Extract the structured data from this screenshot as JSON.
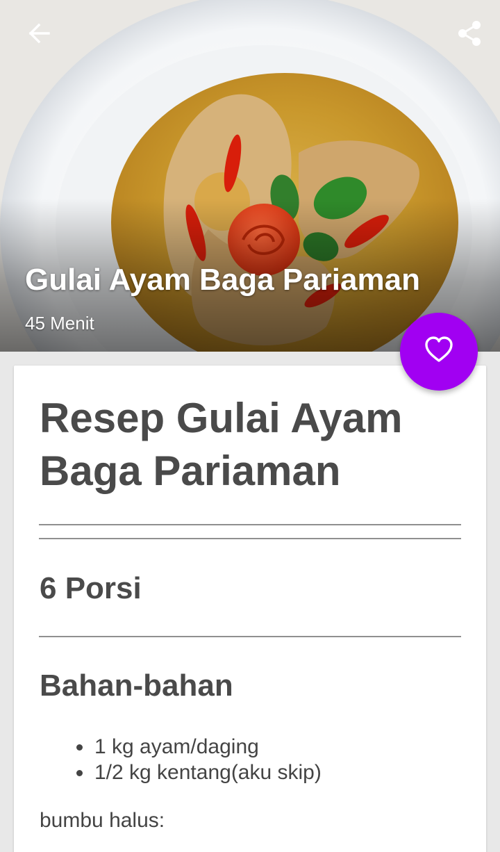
{
  "hero": {
    "title": "Gulai Ayam Baga Pariaman",
    "duration": "45 Menit"
  },
  "toolbar": {
    "back_icon": "arrow-left-icon",
    "share_icon": "share-icon"
  },
  "recipe": {
    "title": "Resep Gulai Ayam Baga Pariaman",
    "portions": "6 Porsi",
    "ingredients_heading": "Bahan-bahan",
    "ingredients": [
      "1 kg ayam/daging",
      "1/2 kg kentang(aku skip)"
    ],
    "subheading": "bumbu halus:"
  },
  "favorite": {
    "icon": "heart-outline-icon"
  },
  "colors": {
    "accent": "#a100f2",
    "text": "#4a4a4a",
    "background": "#e8e8e8"
  }
}
